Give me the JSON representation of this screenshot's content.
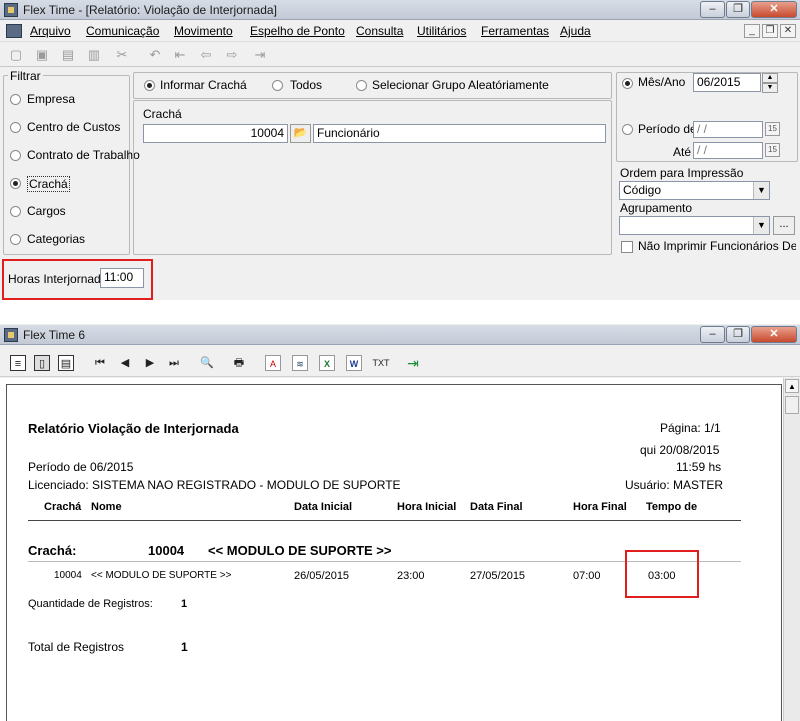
{
  "window1": {
    "title": "Flex Time - [Relatório: Violação de Interjornada]",
    "menu": [
      "Arquivo",
      "Comunicação",
      "Movimento",
      "Espelho de Ponto",
      "Consulta",
      "Utilitários",
      "Ferramentas",
      "Ajuda"
    ]
  },
  "filter": {
    "legend": "Filtrar",
    "options": [
      "Empresa",
      "Centro de Custos",
      "Contrato de Trabalho",
      "Crachá",
      "Cargos",
      "Categorias"
    ],
    "selected": "Crachá"
  },
  "mode": {
    "options": [
      "Informar Crachá",
      "Todos",
      "Selecionar Grupo Aleatóriamente"
    ],
    "selected": "Informar Crachá"
  },
  "cracha": {
    "label": "Crachá",
    "value": "10004",
    "name": "Funcionário"
  },
  "period": {
    "month_year_label": "Mês/Ano",
    "month_year_value": "06/2015",
    "period_label": "Período de",
    "period_from": "/ /",
    "until_label": "Até",
    "period_to": "/ /",
    "order_label": "Ordem para Impressão",
    "order_value": "Código",
    "grouping_label": "Agrupamento",
    "grouping_value": "",
    "more_button": "...",
    "no_print_label": "Não Imprimir Funcionários Demitidos"
  },
  "interjornada": {
    "label": "Horas Interjornada",
    "value": "11:00"
  },
  "window2": {
    "title": "Flex Time 6",
    "txt_label": "TXT"
  },
  "report": {
    "title": "Relatório Violação de Interjornada",
    "page": "Página: 1/1",
    "date": "qui 20/08/2015",
    "time": "11:59 hs",
    "period": "Período de 06/2015",
    "licensed": "Licenciado: SISTEMA NAO REGISTRADO - MODULO DE SUPORTE",
    "user": "Usuário: MASTER",
    "columns": [
      "Crachá",
      "Nome",
      "Data Inicial",
      "Hora Inicial",
      "Data Final",
      "Hora Final",
      "Tempo de"
    ],
    "group_label": "Crachá:",
    "group_code": "10004",
    "group_name": "<< MODULO DE SUPORTE >>",
    "rows": [
      {
        "cracha": "10004",
        "nome": "<< MODULO DE SUPORTE >>",
        "data_inicial": "26/05/2015",
        "hora_inicial": "23:00",
        "data_final": "27/05/2015",
        "hora_final": "07:00",
        "tempo": "03:00"
      }
    ],
    "qty_label": "Quantidade de Registros:",
    "qty_value": "1",
    "total_label": "Total de Registros",
    "total_value": "1"
  },
  "colors": {
    "highlight": "#e01e1e"
  }
}
